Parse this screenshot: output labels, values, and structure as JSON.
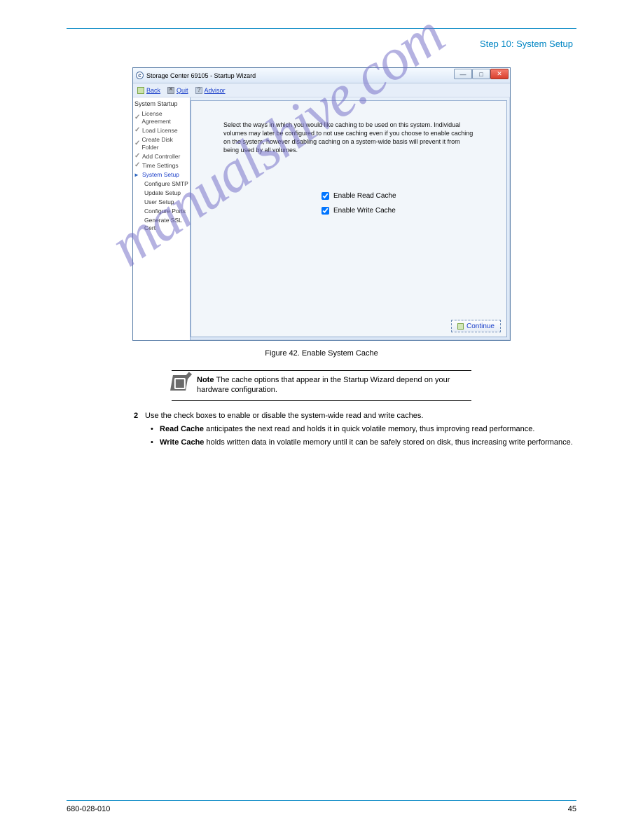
{
  "header_right": "Step 10: System Setup",
  "window": {
    "title": "Storage Center 69105 - Startup Wizard",
    "back": "Back",
    "quit": "Quit",
    "advisor": "Advisor",
    "continue": "Continue"
  },
  "sidebar": {
    "heading": "System Startup",
    "items": [
      "License Agreement",
      "Load License",
      "Create Disk Folder",
      "Add Controller",
      "Time Settings"
    ],
    "active": "System Setup",
    "subs": [
      "Configure SMTP",
      "Update Setup",
      "User Setup",
      "Configure Ports",
      "Generate SSL Cert"
    ]
  },
  "content": {
    "desc": "Select the ways in which you would like caching to be used on this system. Individual volumes may later be configured to not use caching even if you choose to enable caching on the system, however disabling caching on a system-wide basis will prevent it from being used by all volumes.",
    "opt_read": "Enable Read Cache",
    "opt_write": "Enable Write Cache"
  },
  "caption": "Figure 42. Enable System Cache",
  "note": {
    "label": "Note",
    "body": "The cache options that appear in the Startup Wizard depend on your hardware configuration."
  },
  "instr": {
    "num": "2",
    "lead": "Use the check boxes to enable or disable the system-wide read and write caches.",
    "sub1_b": "Read Cache",
    "sub1": " anticipates the next read and holds it in quick volatile memory, thus improving read performance.",
    "sub2_b": "Write Cache",
    "sub2": " holds written data in volatile memory until it can be safely stored on disk, thus increasing write performance."
  },
  "watermark": "manualshive.com",
  "footer": {
    "left": "680-028-010",
    "right": "45"
  }
}
